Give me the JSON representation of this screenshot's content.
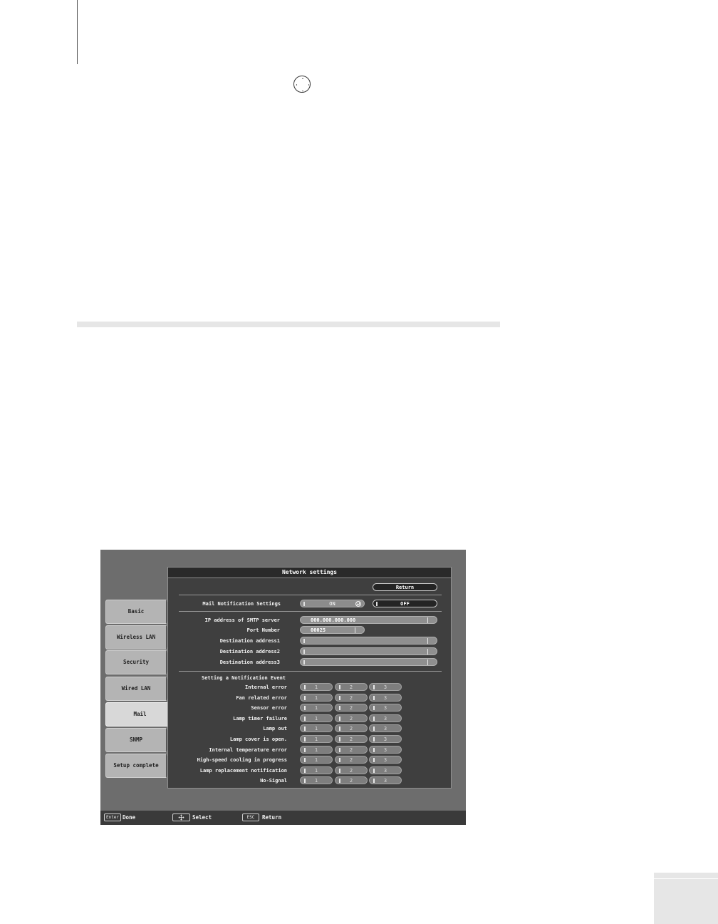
{
  "screen": {
    "title": "Network settings",
    "return_label": "Return",
    "tabs": [
      {
        "label": "Basic"
      },
      {
        "label": "Wireless LAN"
      },
      {
        "label": "Security"
      },
      {
        "label": "Wired LAN"
      },
      {
        "label": "Mail"
      },
      {
        "label": "SNMP"
      },
      {
        "label": "Setup complete"
      }
    ],
    "active_tab": "Mail",
    "mail_notification": {
      "label": "Mail Notification Settings",
      "on_label": "ON",
      "off_label": "OFF",
      "selected": "ON"
    },
    "fields": {
      "smtp_label": "IP address of SMTP server",
      "smtp_value": "000.000.000.000",
      "port_label": "Port Number",
      "port_value": "00025",
      "dest1_label": "Destination address1",
      "dest2_label": "Destination address2",
      "dest3_label": "Destination address3"
    },
    "events_heading": "Setting a Notification Event",
    "checkbox_labels": [
      "1",
      "2",
      "3"
    ],
    "events": [
      {
        "label": "Internal error"
      },
      {
        "label": "Fan related error"
      },
      {
        "label": "Sensor error"
      },
      {
        "label": "Lamp timer failure"
      },
      {
        "label": "Lamp out"
      },
      {
        "label": "Lamp cover is open."
      },
      {
        "label": "Internal temperature error"
      },
      {
        "label": "High-speed cooling in progress"
      },
      {
        "label": "Lamp replacement notification"
      },
      {
        "label": "No-Signal"
      }
    ],
    "footer": {
      "enter_key": "Enter",
      "enter_label": "Done",
      "select_label": "Select",
      "esc_key": "ESC",
      "esc_label": "Return"
    }
  },
  "icons": {
    "page_nav": "four-way-arrow-icon",
    "select": "four-way-arrow-icon",
    "enter_return": "enter-return-icon"
  },
  "colors": {
    "screen_bg": "#6d6d6d",
    "panel_bg": "#3f3f3f",
    "tab_bg": "#b4b4b4",
    "tab_active_bg": "#d8d8d8"
  }
}
